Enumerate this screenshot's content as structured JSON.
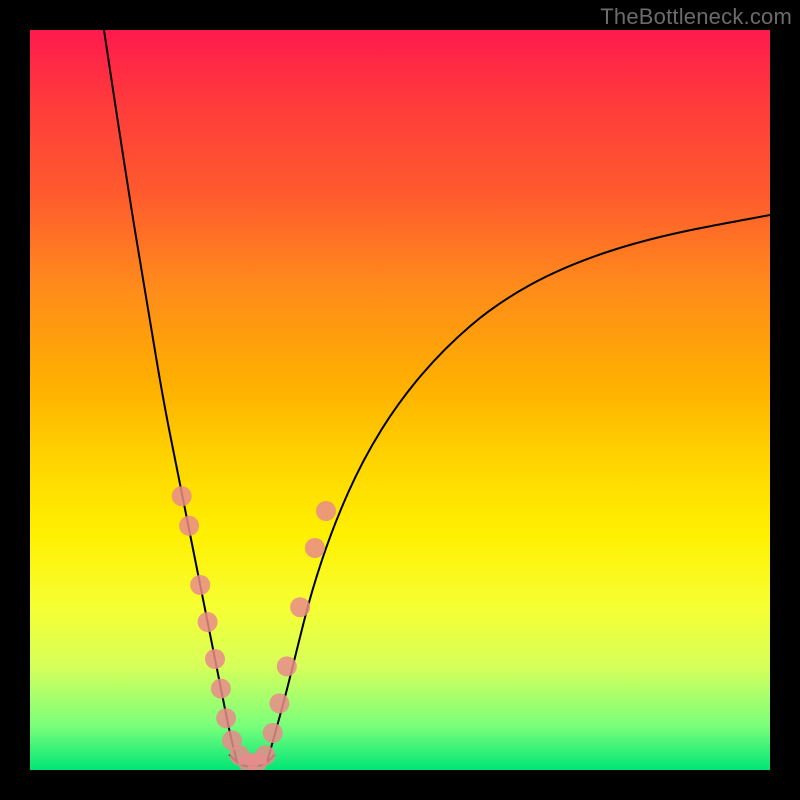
{
  "watermark": "TheBottleneck.com",
  "chart_data": {
    "type": "line",
    "title": "",
    "xlabel": "",
    "ylabel": "",
    "xlim": [
      0,
      100
    ],
    "ylim": [
      0,
      100
    ],
    "annotations": [],
    "series": [
      {
        "name": "left-curve",
        "x": [
          10,
          13,
          16,
          18,
          20,
          22,
          24,
          26,
          27,
          28
        ],
        "values": [
          100,
          80,
          62,
          50,
          40,
          30,
          20,
          10,
          5,
          1
        ]
      },
      {
        "name": "right-curve",
        "x": [
          32,
          34,
          36,
          38,
          41,
          45,
          50,
          56,
          63,
          72,
          84,
          100
        ],
        "values": [
          1,
          8,
          16,
          24,
          33,
          42,
          50,
          57,
          63,
          68,
          72,
          75
        ]
      },
      {
        "name": "valley-floor",
        "x": [
          27,
          28,
          29,
          30,
          31,
          32,
          33
        ],
        "values": [
          2,
          1,
          0.5,
          0.5,
          0.5,
          1,
          2
        ]
      }
    ],
    "scatter_points": {
      "name": "highlight-dots",
      "color": "#e98b8b",
      "points": [
        {
          "x": 20.5,
          "y": 37
        },
        {
          "x": 21.5,
          "y": 33
        },
        {
          "x": 23.0,
          "y": 25
        },
        {
          "x": 24.0,
          "y": 20
        },
        {
          "x": 25.0,
          "y": 15
        },
        {
          "x": 25.8,
          "y": 11
        },
        {
          "x": 26.5,
          "y": 7
        },
        {
          "x": 27.3,
          "y": 4
        },
        {
          "x": 28.3,
          "y": 2
        },
        {
          "x": 29.5,
          "y": 1
        },
        {
          "x": 30.7,
          "y": 1
        },
        {
          "x": 31.8,
          "y": 2
        },
        {
          "x": 32.8,
          "y": 5
        },
        {
          "x": 33.7,
          "y": 9
        },
        {
          "x": 34.7,
          "y": 14
        },
        {
          "x": 36.5,
          "y": 22
        },
        {
          "x": 38.5,
          "y": 30
        },
        {
          "x": 40.0,
          "y": 35
        }
      ]
    }
  }
}
